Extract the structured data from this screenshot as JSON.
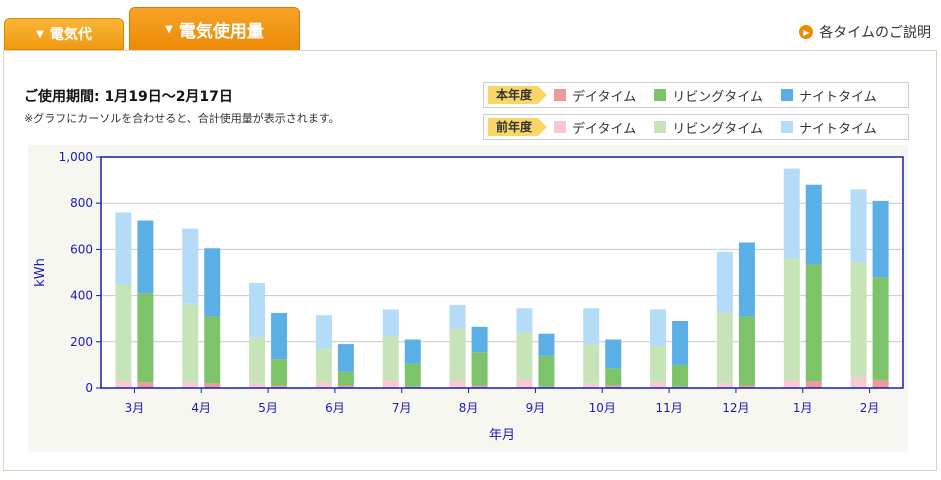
{
  "tabs": {
    "electricity_fee": "電気代",
    "electricity_usage": "電気使用量"
  },
  "help_link": "各タイムのご説明",
  "period": "ご使用期間: 1月19日～2月17日",
  "note": "※グラフにカーソルを合わせると、合計使用量が表示されます。",
  "legend": {
    "current_label": "本年度",
    "previous_label": "前年度",
    "day": "デイタイム",
    "living": "リビングタイム",
    "night": "ナイトタイム"
  },
  "colors": {
    "cur_day": "#ec9a9a",
    "cur_living": "#7dc36a",
    "cur_night": "#5ab0e6",
    "prev_day": "#f8c9cf",
    "prev_living": "#c7e4b9",
    "prev_night": "#b5dcf6",
    "axis": "#1a1ab8",
    "grid": "#c9c9c9"
  },
  "chart_data": {
    "type": "bar",
    "stacked": true,
    "grouped": true,
    "xlabel": "年月",
    "ylabel": "kWh",
    "ylim": [
      0,
      1000
    ],
    "yticks": [
      "0",
      "200",
      "400",
      "600",
      "800",
      "1,000"
    ],
    "categories": [
      "3月",
      "4月",
      "5月",
      "6月",
      "7月",
      "8月",
      "9月",
      "10月",
      "11月",
      "12月",
      "1月",
      "2月"
    ],
    "groups": [
      {
        "name": "前年度",
        "series": [
          {
            "name": "デイタイム",
            "values": [
              30,
              25,
              20,
              25,
              35,
              30,
              35,
              20,
              25,
              20,
              35,
              45
            ]
          },
          {
            "name": "リビングタイム",
            "values": [
              420,
              340,
              200,
              145,
              190,
              225,
              205,
              170,
              155,
              305,
              525,
              500
            ]
          },
          {
            "name": "ナイトタイム",
            "values": [
              310,
              325,
              235,
              145,
              115,
              105,
              105,
              155,
              160,
              265,
              390,
              315
            ]
          }
        ]
      },
      {
        "name": "本年度",
        "series": [
          {
            "name": "デイタイム",
            "values": [
              25,
              20,
              10,
              10,
              5,
              10,
              5,
              10,
              5,
              10,
              30,
              35
            ]
          },
          {
            "name": "リビングタイム",
            "values": [
              385,
              290,
              115,
              60,
              100,
              145,
              135,
              75,
              95,
              300,
              505,
              445
            ]
          },
          {
            "name": "ナイトタイム",
            "values": [
              315,
              295,
              200,
              120,
              105,
              110,
              95,
              125,
              190,
              320,
              345,
              330
            ]
          }
        ]
      }
    ]
  }
}
